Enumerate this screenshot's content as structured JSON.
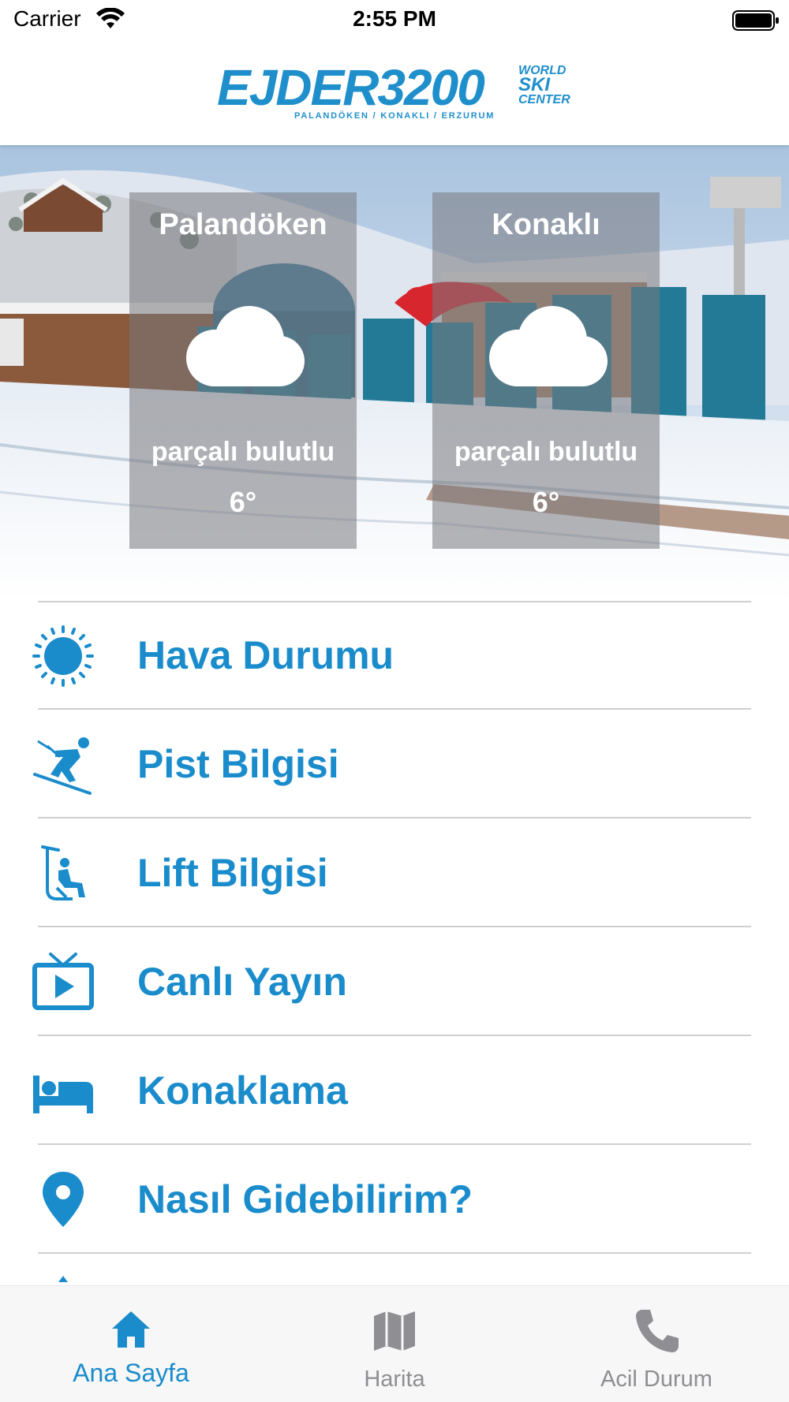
{
  "status_bar": {
    "carrier": "Carrier",
    "time": "2:55 PM"
  },
  "header": {
    "logo_main": "EJDER3200",
    "logo_side_world": "WORLD",
    "logo_side_ski": "SKI",
    "logo_side_center": "CENTER",
    "logo_sub": "PALANDÖKEN / KONAKLI / ERZURUM"
  },
  "weather_cards": [
    {
      "location": "Palandöken",
      "condition": "parçalı bulutlu",
      "temperature": "6°",
      "icon": "cloud-icon"
    },
    {
      "location": "Konaklı",
      "condition": "parçalı bulutlu",
      "temperature": "6°",
      "icon": "cloud-icon"
    }
  ],
  "menu": {
    "items": [
      {
        "label": "Hava Durumu",
        "icon": "sun-icon"
      },
      {
        "label": "Pist Bilgisi",
        "icon": "skier-icon"
      },
      {
        "label": "Lift Bilgisi",
        "icon": "chairlift-icon"
      },
      {
        "label": "Canlı Yayın",
        "icon": "tv-play-icon"
      },
      {
        "label": "Konaklama",
        "icon": "bed-icon"
      },
      {
        "label": "Nasıl Gidebilirim?",
        "icon": "location-pin-icon"
      }
    ]
  },
  "tab_bar": {
    "tabs": [
      {
        "label": "Ana Sayfa",
        "icon": "home-icon",
        "active": true
      },
      {
        "label": "Harita",
        "icon": "map-icon",
        "active": false
      },
      {
        "label": "Acil Durum",
        "icon": "phone-icon",
        "active": false
      }
    ]
  },
  "colors": {
    "accent": "#1a8ccc",
    "tab_inactive": "#8e8e93",
    "card_overlay": "rgba(120,120,125,0.55)"
  }
}
